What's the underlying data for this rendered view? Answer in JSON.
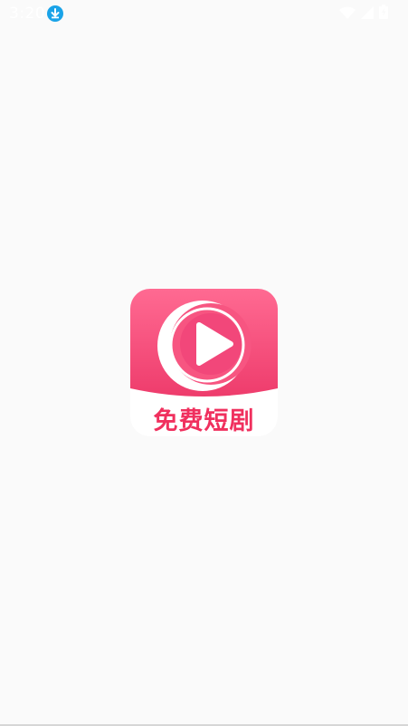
{
  "status_bar": {
    "time": "3:20",
    "icons": [
      "download-icon",
      "wifi-icon",
      "signal-icon",
      "battery-icon"
    ]
  },
  "splash": {
    "app_name": "免费短剧",
    "logo_icon": "play-icon",
    "colors": {
      "brand_pink": "#ff5a86",
      "brand_pink_dark": "#ef3a6b",
      "caption_red": "#f0305e",
      "background": "#fafafa"
    }
  }
}
